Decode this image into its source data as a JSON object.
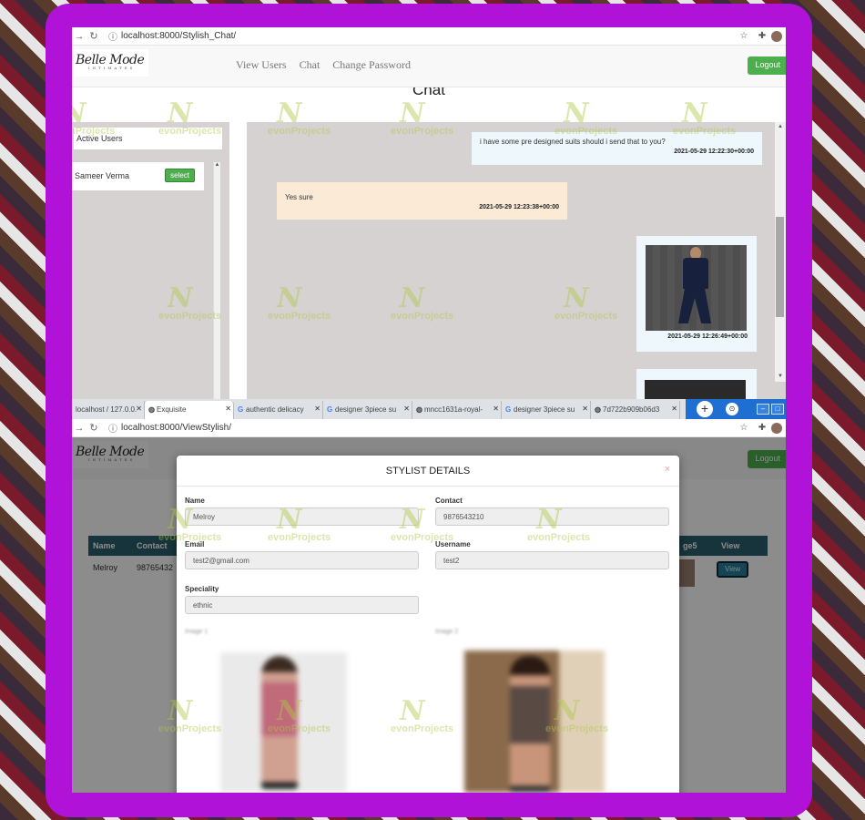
{
  "chat_window": {
    "url": "localhost:8000/Stylish_Chat/",
    "logo": "Belle Mode",
    "logo_sub": "INTIMATES",
    "nav": [
      "View Users",
      "Chat",
      "Change Password"
    ],
    "logout_label": "Logout",
    "page_title": "Chat",
    "users_panel_title": "Active Users",
    "users": [
      {
        "name": "Sameer Verma",
        "button": "select"
      }
    ],
    "messages": [
      {
        "text": "i have some pre designed suits should i send that to you?",
        "time": "2021-05-29 12:22:30+00:00",
        "side": "right"
      },
      {
        "text": "Yes sure",
        "time": "2021-05-29 12:23:38+00:00",
        "side": "left"
      },
      {
        "image": "navy-suit-photo",
        "time": "2021-05-29 12:26:49+00:00",
        "side": "right"
      }
    ]
  },
  "tabs": [
    {
      "label": "localhost / 127.0.0.",
      "icon": "page-icon"
    },
    {
      "label": "Exquisite",
      "icon": "globe-icon",
      "active": true
    },
    {
      "label": "authentic delicacy",
      "icon": "google-icon"
    },
    {
      "label": "designer 3piece su",
      "icon": "google-icon"
    },
    {
      "label": "mncc1631a-royal-",
      "icon": "globe-icon"
    },
    {
      "label": "designer 3piece su",
      "icon": "google-icon"
    },
    {
      "label": "7d722b909b06d3",
      "icon": "globe-icon"
    }
  ],
  "stylist_window": {
    "url": "localhost:8000/ViewStylish/",
    "logout_label": "Logout",
    "table_headers": [
      "Name",
      "Contact",
      "ge5",
      "View"
    ],
    "table_row": {
      "name": "Melroy",
      "contact": "98765432",
      "view_label": "View"
    },
    "modal": {
      "title": "STYLIST DETAILS",
      "close": "×",
      "fields": [
        {
          "label": "Name",
          "value": "Melroy"
        },
        {
          "label": "Contact",
          "value": "9876543210"
        },
        {
          "label": "Email",
          "value": "test2@gmail.com"
        },
        {
          "label": "Username",
          "value": "test2"
        },
        {
          "label": "Speciality",
          "value": "ethnic"
        }
      ],
      "image_labels": [
        "Image 1",
        "Image 2"
      ]
    }
  },
  "watermark": {
    "logo_letter": "N",
    "brand_prefix": "evon",
    "brand_suffix": "Projects"
  },
  "colors": {
    "frame": "#b012d8",
    "success": "#4cae4c",
    "table_header": "#2b5e6c",
    "chat_bg": "#d6d2d2",
    "outgoing": "#eef7fb",
    "incoming": "#fbebd6"
  }
}
